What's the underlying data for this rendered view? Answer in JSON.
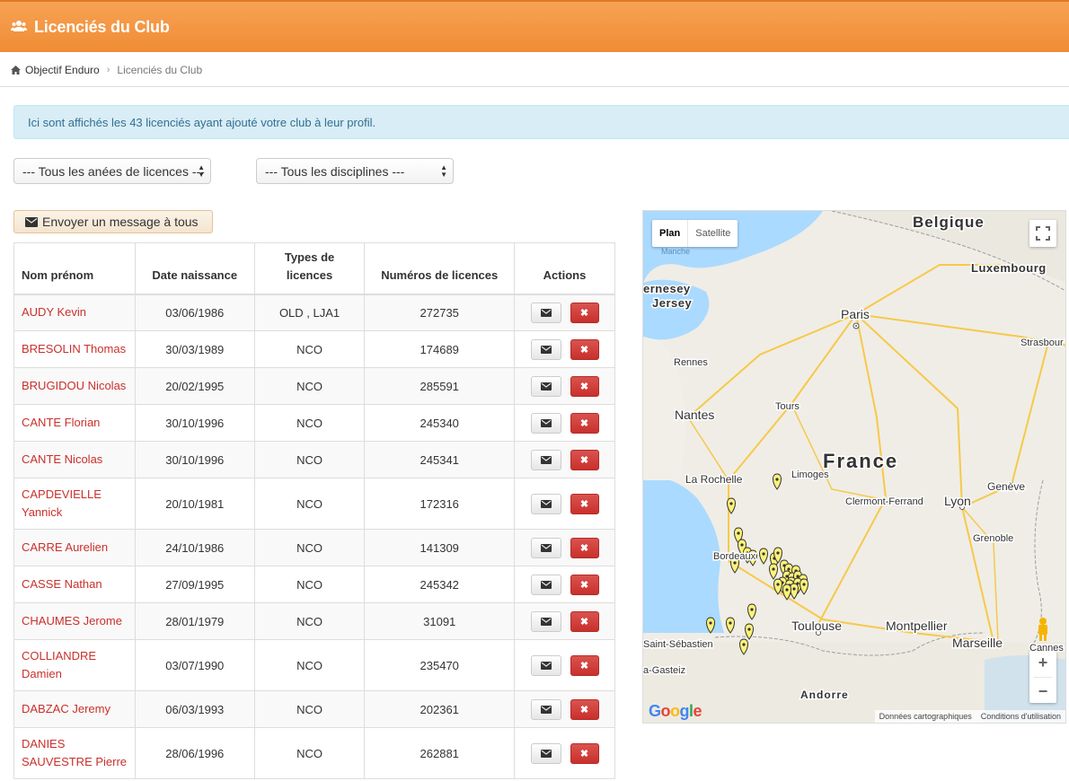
{
  "header": {
    "title": "Licenciés du Club",
    "icon": "users-icon"
  },
  "breadcrumb": {
    "home": "Objectif Enduro",
    "current": "Licenciés du Club"
  },
  "alert": {
    "text": "Ici sont affichés les 43 licenciés ayant ajouté votre club à leur profil."
  },
  "filters": {
    "years": "--- Tous les anées de licences ---",
    "disciplines": "--- Tous les disciplines ---"
  },
  "send_all_label": "Envoyer un message à tous",
  "table": {
    "headers": [
      "Nom prénom",
      "Date naissance",
      "Types de licences",
      "Numéros de licences",
      "Actions"
    ],
    "rows": [
      {
        "name": "AUDY Kevin",
        "birth": "03/06/1986",
        "types": "OLD , LJA1",
        "number": "272735"
      },
      {
        "name": "BRESOLIN Thomas",
        "birth": "30/03/1989",
        "types": "NCO",
        "number": "174689"
      },
      {
        "name": "BRUGIDOU Nicolas",
        "birth": "20/02/1995",
        "types": "NCO",
        "number": "285591"
      },
      {
        "name": "CANTE Florian",
        "birth": "30/10/1996",
        "types": "NCO",
        "number": "245340"
      },
      {
        "name": "CANTE Nicolas",
        "birth": "30/10/1996",
        "types": "NCO",
        "number": "245341"
      },
      {
        "name": "CAPDEVIELLE Yannick",
        "birth": "20/10/1981",
        "types": "NCO",
        "number": "172316"
      },
      {
        "name": "CARRE Aurelien",
        "birth": "24/10/1986",
        "types": "NCO",
        "number": "141309"
      },
      {
        "name": "CASSE Nathan",
        "birth": "27/09/1995",
        "types": "NCO",
        "number": "245342"
      },
      {
        "name": "CHAUMES Jerome",
        "birth": "28/01/1979",
        "types": "NCO",
        "number": "31091"
      },
      {
        "name": "COLLIANDRE Damien",
        "birth": "03/07/1990",
        "types": "NCO",
        "number": "235470"
      },
      {
        "name": "DABZAC Jeremy",
        "birth": "06/03/1993",
        "types": "NCO",
        "number": "202361"
      },
      {
        "name": "DANIES SAUVESTRE Pierre",
        "birth": "28/06/1996",
        "types": "NCO",
        "number": "262881"
      }
    ]
  },
  "map": {
    "type_plan": "Plan",
    "type_satellite": "Satellite",
    "zoom_in": "+",
    "zoom_out": "−",
    "attribution_data": "Données cartographiques",
    "attribution_terms": "Conditions d'utilisation",
    "logo": "Google",
    "labels": {
      "belgique": "Belgique",
      "luxembourg": "Luxembourg",
      "jersey1": "ernesey",
      "jersey2": "Jersey",
      "paris": "Paris",
      "strasbourg": "Strasbour",
      "rennes": "Rennes",
      "tours": "Tours",
      "nantes": "Nantes",
      "france": "France",
      "rochelle": "La Rochelle",
      "limoges": "Limoges",
      "clermont": "Clermont-Ferrand",
      "lyon": "Lyon",
      "geneve": "Genève",
      "grenoble": "Grenoble",
      "bordeaux": "Bordeaux",
      "toulouse": "Toulouse",
      "montpellier": "Montpellier",
      "marseille": "Marseille",
      "sebastien": "Saint-Sébastien",
      "gasteiz": "a-Gasteiz",
      "andorre": "Andorre",
      "cannes": "Cannes",
      "manche": "Manche"
    }
  }
}
